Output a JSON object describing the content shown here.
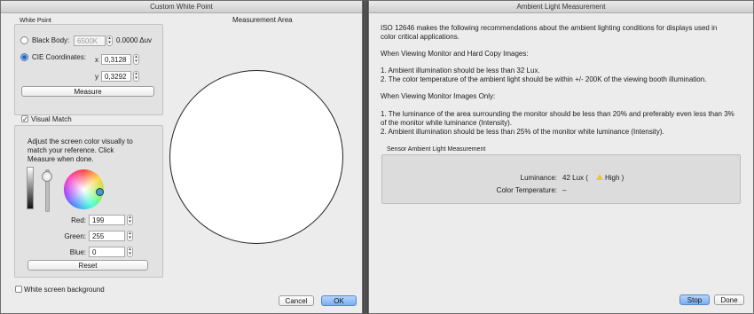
{
  "background_left_fragment": "Cu",
  "custom_white_point": {
    "title": "Custom White Point",
    "white_point_group_label": "White Point",
    "black_body_label": "Black Body:",
    "black_body_value": "6500K",
    "delta_uv": "0.0000 Δuv",
    "cie_label": "CIE Coordinates:",
    "x_label": "x",
    "x_value": "0,3128",
    "y_label": "y",
    "y_value": "0,3292",
    "measure_button": "Measure",
    "visual_match_label": "Visual Match",
    "instruction": "Adjust the screen color visually to match your reference. Click Measure when done.",
    "red_label": "Red:",
    "red_value": "199",
    "green_label": "Green:",
    "green_value": "255",
    "blue_label": "Blue:",
    "blue_value": "0",
    "reset_button": "Reset",
    "white_screen_label": "White screen background",
    "measurement_area_label": "Measurement Area",
    "cancel_button": "Cancel",
    "ok_button": "OK",
    "brightness_level": 0.95
  },
  "ambient": {
    "title": "Ambient Light Measurement",
    "intro_line1": "ISO 12646 makes the following recommendations about the ambient lighting conditions for displays used in",
    "intro_line2": "color critical applications.",
    "section1_heading": "When Viewing Monitor and Hard Copy Images:",
    "s1_item1": "1. Ambient illumination should be less than 32 Lux.",
    "s1_item2": "2. The color temperature of the ambient light should be within +/- 200K of the viewing booth illumination.",
    "section2_heading": "When Viewing Monitor Images Only:",
    "s2_item1_line1": "1. The luminance of the area surrounding the monitor should be less than 20% and preferably even less than 3%",
    "s2_item1_line2": "of the monitor white luminance (Intensity).",
    "s2_item2": "2. Ambient illumination should be less than 25% of the monitor white luminance (Intensity).",
    "sensor_group_label": "Sensor Ambient Light Measurement",
    "luminance_label": "Luminance:",
    "luminance_value": "42 Lux (",
    "luminance_level": "High )",
    "color_temp_label": "Color Temperature:",
    "color_temp_value": "–",
    "stop_button": "Stop",
    "done_button": "Done"
  },
  "colors": {
    "accent": "#6aa0e4",
    "window_bg": "#ececec",
    "desktop": "#5b5b5b",
    "warning_icon": "#e7c640"
  }
}
